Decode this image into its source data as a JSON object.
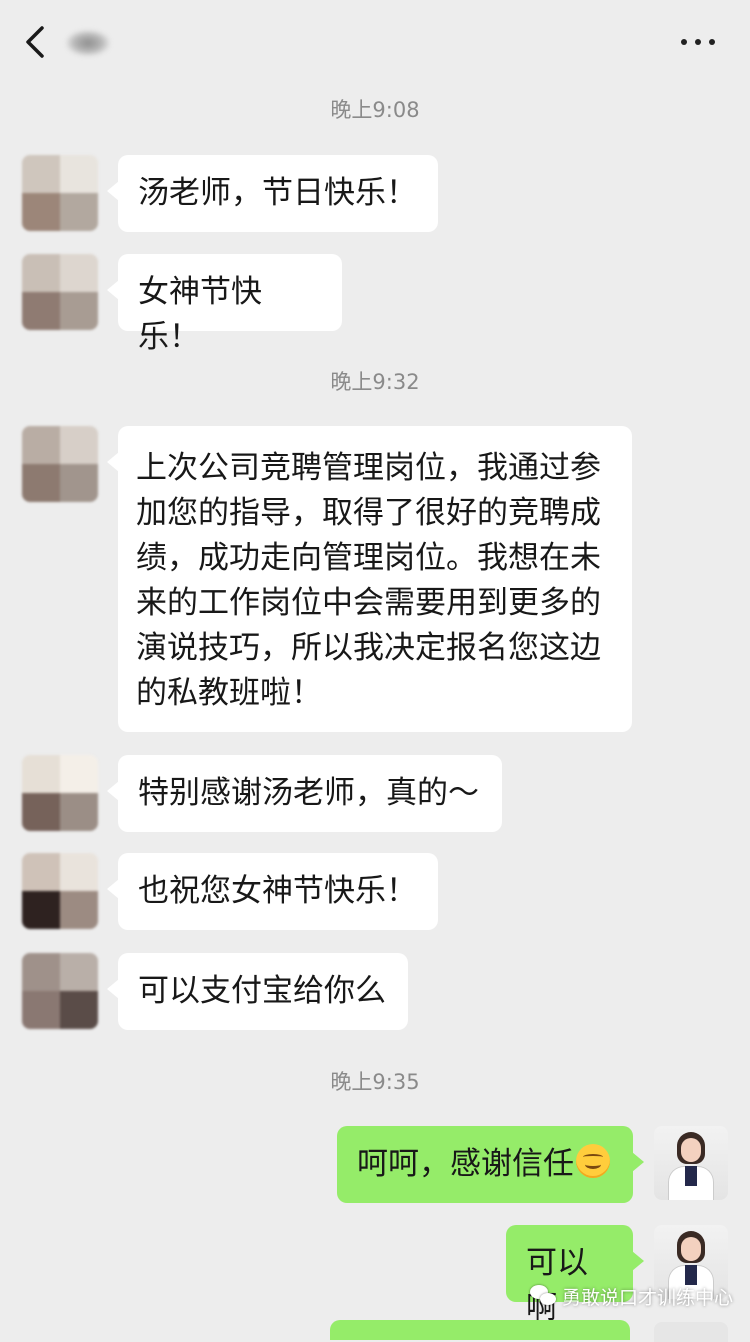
{
  "header": {
    "title": "",
    "back_icon": "chevron-left-icon",
    "more_icon": "more-horizontal-icon"
  },
  "messages": {
    "ts1": "晚上9:08",
    "m1": "汤老师，节日快乐！",
    "m2": "女神节快乐！",
    "ts2": "晚上9:32",
    "m3": "上次公司竞聘管理岗位，我通过参加您的指导，取得了很好的竞聘成绩，成功走向管理岗位。我想在未来的工作岗位中会需要用到更多的演说技巧，所以我决定报名您这边的私教班啦！",
    "m4": "特别感谢汤老师，真的～",
    "m5": "也祝您女神节快乐！",
    "m6": "可以支付宝给你么",
    "ts3": "晚上9:35",
    "m7": "呵呵，感谢信任",
    "m8": "可以啊"
  },
  "watermark": {
    "text": "勇敢说口才训练中心"
  },
  "colors": {
    "background": "#ededed",
    "incoming_bubble": "#ffffff",
    "outgoing_bubble": "#95ec69",
    "timestamp": "#8a8a8a"
  }
}
